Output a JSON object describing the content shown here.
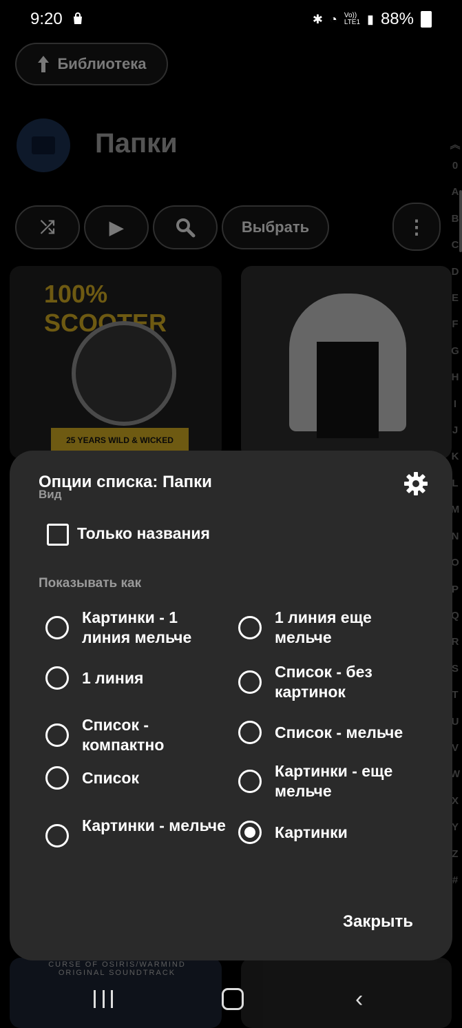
{
  "status_bar": {
    "time": "9:20",
    "battery": "88%",
    "network": "Vo))\nLTE1"
  },
  "background": {
    "library_button": "Библиотека",
    "page_title": "Папки",
    "select_button": "Выбрать",
    "alphabet_index": [
      "0",
      "A",
      "B",
      "C",
      "D",
      "E",
      "F",
      "G",
      "H",
      "I",
      "J",
      "K",
      "L",
      "M",
      "N",
      "O",
      "P",
      "Q",
      "R",
      "S",
      "T",
      "U",
      "V",
      "W",
      "X",
      "Y",
      "Z",
      "#"
    ],
    "tiles": [
      {
        "title": "100% SCOOTER",
        "subtitle": "25 YEARS WILD & WICKED"
      },
      {
        "title": ""
      },
      {
        "title": "CURSE OF OSIRIS/WARMIND ORIGINAL SOUNDTRACK"
      },
      {
        "title": ""
      }
    ]
  },
  "sheet": {
    "title": "Опции списка: Папки",
    "view_section": "Вид",
    "only_names_label": "Только названия",
    "only_names_checked": false,
    "show_as_label": "Показывать как",
    "options_left": [
      {
        "label": "Картинки - 1 линия мельче",
        "selected": false
      },
      {
        "label": "1 линия",
        "selected": false
      },
      {
        "label": "Список - компактно",
        "selected": false
      },
      {
        "label": "Список",
        "selected": false
      },
      {
        "label": "Картинки - мельче",
        "selected": false
      }
    ],
    "options_right": [
      {
        "label": "1 линия еще мельче",
        "selected": false
      },
      {
        "label": "Список - без картинок",
        "selected": false
      },
      {
        "label": "Список - мельче",
        "selected": false
      },
      {
        "label": "Картинки - еще мельче",
        "selected": false
      },
      {
        "label": "Картинки",
        "selected": true
      }
    ],
    "close_button": "Закрыть"
  },
  "colors": {
    "sheet_bg": "#2a2a2a",
    "accent": "#ffffff",
    "folder_circle": "#1b2e4d"
  }
}
